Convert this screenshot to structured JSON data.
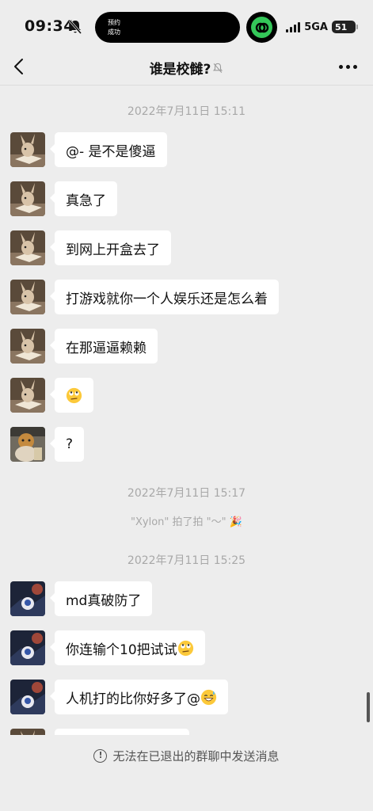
{
  "status_bar": {
    "time": "09:34",
    "island_line1": "预约",
    "island_line2": "成功",
    "network": "5GA",
    "battery": "51"
  },
  "nav": {
    "title": "谁是校雠?",
    "back_icon": "chevron-left-icon",
    "more_icon": "more-icon",
    "muted_icon": "bell-off-icon"
  },
  "chat": {
    "timestamp_1": "2022年7月11日 15:11",
    "timestamp_2": "2022年7月11日 15:17",
    "timestamp_3": "2022年7月11日 15:25",
    "system_pat": "\"Xylon\" 拍了拍 \"～\"",
    "messages": [
      {
        "text": "@- 是不是傻逼"
      },
      {
        "text": "真急了"
      },
      {
        "text": "到网上开盒去了"
      },
      {
        "text": "打游戏就你一个人娱乐还是怎么着"
      },
      {
        "text": "在那逼逼赖赖"
      },
      {
        "text": "",
        "emoji": "face-with-rolling-eyes"
      },
      {
        "text": "?"
      },
      {
        "text": "md真破防了"
      },
      {
        "text": "你连输个10把试试",
        "emoji": "face-with-rolling-eyes"
      },
      {
        "text": "人机打的比你好多了@",
        "emoji": "grinning-sweat"
      }
    ]
  },
  "footer": {
    "notice": "无法在已退出的群聊中发送消息",
    "notice_icon": "info-circle-icon"
  },
  "colors": {
    "background": "#ededed",
    "bubble": "#ffffff",
    "timestamp": "#a8a8a8"
  }
}
